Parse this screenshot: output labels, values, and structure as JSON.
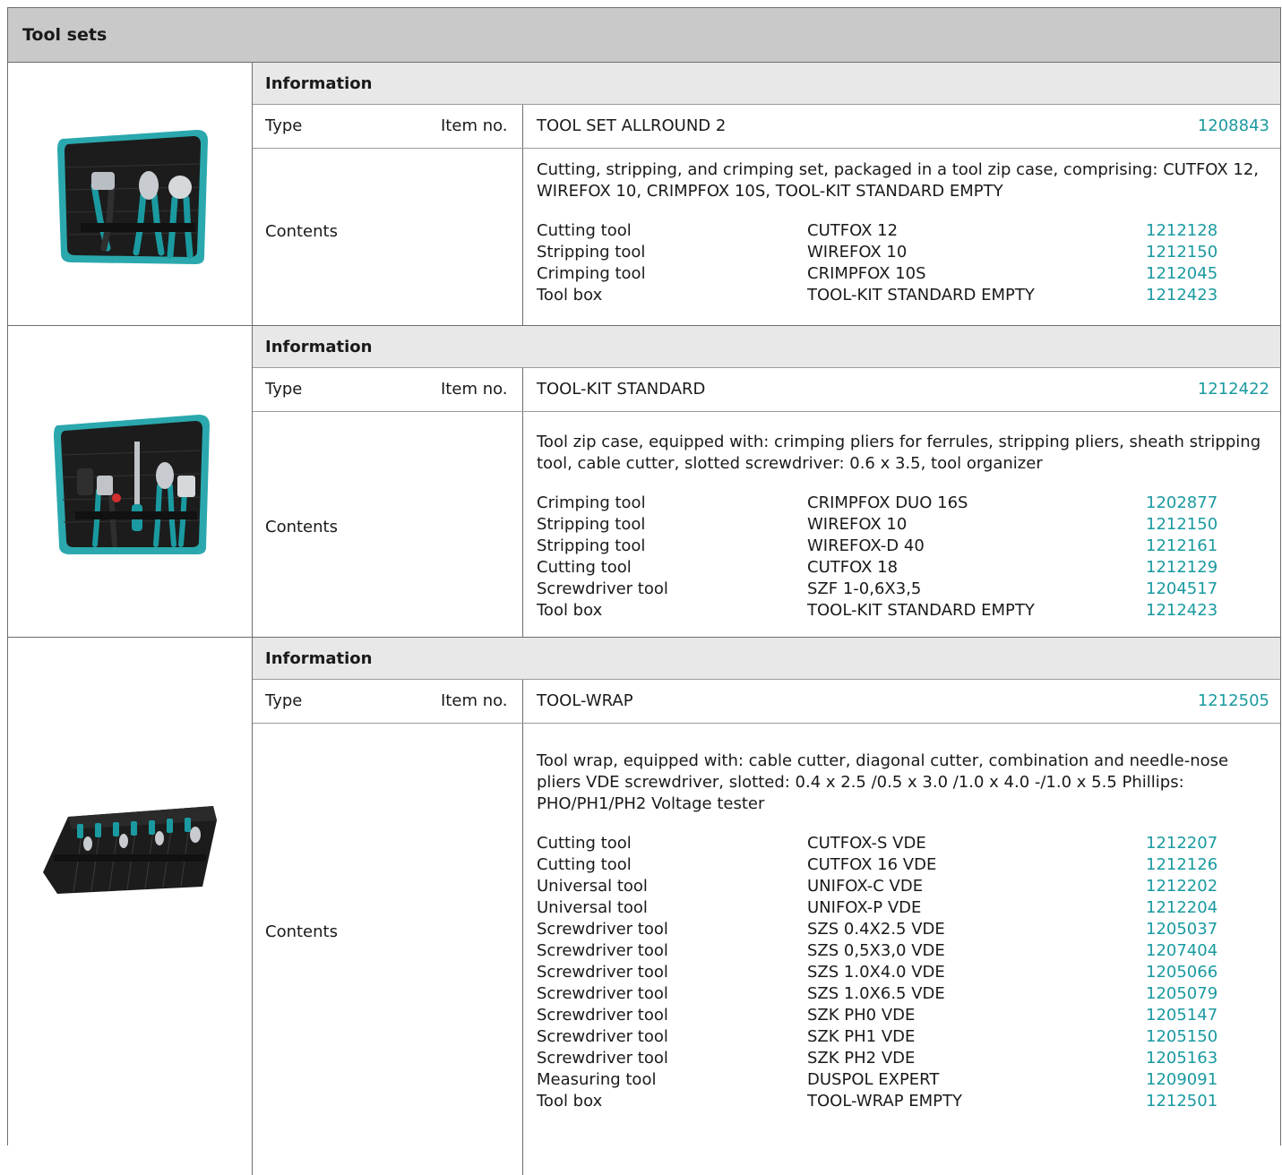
{
  "title": "Tool sets",
  "labels": {
    "information": "Information",
    "type": "Type",
    "item_no": "Item no.",
    "contents": "Contents"
  },
  "colors": {
    "link": "#1a9aa0",
    "header_bg": "#c9c9c9",
    "info_bg": "#e8e8e8"
  },
  "products": [
    {
      "image": "tool-set-allround-2-case",
      "name": "TOOL SET ALLROUND 2",
      "code": "1208843",
      "description": "Cutting, stripping, and crimping set, packaged in a tool zip case, comprising: CUTFOX 12, WIREFOX 10, CRIMPFOX 10S, TOOL-KIT STANDARD EMPTY",
      "components": [
        {
          "category": "Cutting tool",
          "name": "CUTFOX 12",
          "code": "1212128"
        },
        {
          "category": "Stripping tool",
          "name": "WIREFOX 10",
          "code": "1212150"
        },
        {
          "category": "Crimping tool",
          "name": "CRIMPFOX 10S",
          "code": "1212045"
        },
        {
          "category": "Tool box",
          "name": "TOOL-KIT STANDARD EMPTY",
          "code": "1212423"
        }
      ]
    },
    {
      "image": "tool-kit-standard-case",
      "name": "TOOL-KIT STANDARD",
      "code": "1212422",
      "description": "Tool zip case, equipped with: crimping pliers for ferrules, stripping pliers, sheath stripping tool, cable cutter, slotted screwdriver: 0.6 x 3.5, tool organizer",
      "components": [
        {
          "category": "Crimping tool",
          "name": "CRIMPFOX DUO 16S",
          "code": "1202877"
        },
        {
          "category": "Stripping tool",
          "name": "WIREFOX 10",
          "code": "1212150"
        },
        {
          "category": "Stripping tool",
          "name": "WIREFOX-D 40",
          "code": "1212161"
        },
        {
          "category": "Cutting tool",
          "name": "CUTFOX 18",
          "code": "1212129"
        },
        {
          "category": "Screwdriver tool",
          "name": "SZF 1-0,6X3,5",
          "code": "1204517"
        },
        {
          "category": "Tool box",
          "name": "TOOL-KIT STANDARD EMPTY",
          "code": "1212423"
        }
      ]
    },
    {
      "image": "tool-wrap-roll",
      "name": "TOOL-WRAP",
      "code": "1212505",
      "description": "Tool wrap, equipped with: cable cutter, diagonal cutter, combination and needle-nose pliers VDE screwdriver, slotted: 0.4 x 2.5 /0.5 x 3.0 /1.0 x 4.0 -/1.0 x 5.5 Phillips: PHO/PH1/PH2 Voltage tester",
      "components": [
        {
          "category": "Cutting tool",
          "name": "CUTFOX-S VDE",
          "code": "1212207"
        },
        {
          "category": "Cutting tool",
          "name": "CUTFOX 16 VDE",
          "code": "1212126"
        },
        {
          "category": "Universal tool",
          "name": "UNIFOX-C VDE",
          "code": "1212202"
        },
        {
          "category": "Universal tool",
          "name": "UNIFOX-P VDE",
          "code": "1212204"
        },
        {
          "category": "Screwdriver tool",
          "name": "SZS 0.4X2.5 VDE",
          "code": "1205037"
        },
        {
          "category": "Screwdriver tool",
          "name": "SZS 0,5X3,0 VDE",
          "code": "1207404"
        },
        {
          "category": "Screwdriver tool",
          "name": "SZS 1.0X4.0 VDE",
          "code": "1205066"
        },
        {
          "category": "Screwdriver tool",
          "name": "SZS 1.0X6.5 VDE",
          "code": "1205079"
        },
        {
          "category": "Screwdriver tool",
          "name": "SZK PH0 VDE",
          "code": "1205147"
        },
        {
          "category": "Screwdriver tool",
          "name": "SZK PH1 VDE",
          "code": "1205150"
        },
        {
          "category": "Screwdriver tool",
          "name": "SZK PH2 VDE",
          "code": "1205163"
        },
        {
          "category": "Measuring tool",
          "name": "DUSPOL EXPERT",
          "code": "1209091"
        },
        {
          "category": "Tool box",
          "name": "TOOL-WRAP EMPTY",
          "code": "1212501"
        }
      ]
    }
  ]
}
